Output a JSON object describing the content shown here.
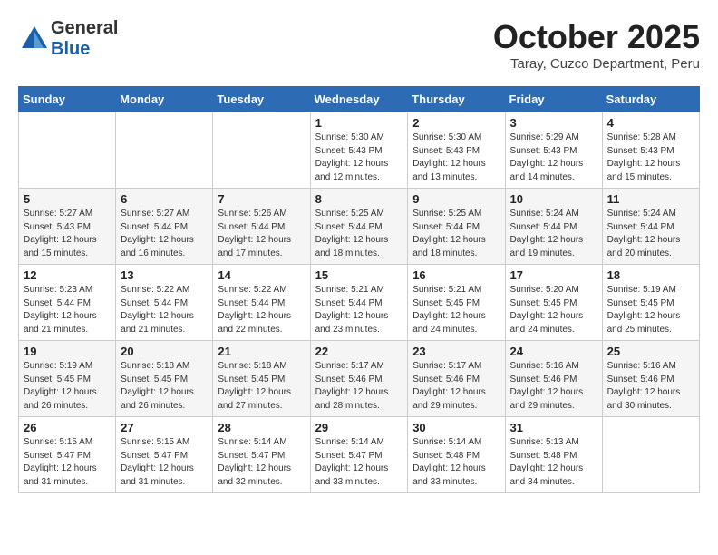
{
  "header": {
    "logo_general": "General",
    "logo_blue": "Blue",
    "month": "October 2025",
    "location": "Taray, Cuzco Department, Peru"
  },
  "weekdays": [
    "Sunday",
    "Monday",
    "Tuesday",
    "Wednesday",
    "Thursday",
    "Friday",
    "Saturday"
  ],
  "weeks": [
    [
      {
        "day": "",
        "info": ""
      },
      {
        "day": "",
        "info": ""
      },
      {
        "day": "",
        "info": ""
      },
      {
        "day": "1",
        "info": "Sunrise: 5:30 AM\nSunset: 5:43 PM\nDaylight: 12 hours\nand 12 minutes."
      },
      {
        "day": "2",
        "info": "Sunrise: 5:30 AM\nSunset: 5:43 PM\nDaylight: 12 hours\nand 13 minutes."
      },
      {
        "day": "3",
        "info": "Sunrise: 5:29 AM\nSunset: 5:43 PM\nDaylight: 12 hours\nand 14 minutes."
      },
      {
        "day": "4",
        "info": "Sunrise: 5:28 AM\nSunset: 5:43 PM\nDaylight: 12 hours\nand 15 minutes."
      }
    ],
    [
      {
        "day": "5",
        "info": "Sunrise: 5:27 AM\nSunset: 5:43 PM\nDaylight: 12 hours\nand 15 minutes."
      },
      {
        "day": "6",
        "info": "Sunrise: 5:27 AM\nSunset: 5:44 PM\nDaylight: 12 hours\nand 16 minutes."
      },
      {
        "day": "7",
        "info": "Sunrise: 5:26 AM\nSunset: 5:44 PM\nDaylight: 12 hours\nand 17 minutes."
      },
      {
        "day": "8",
        "info": "Sunrise: 5:25 AM\nSunset: 5:44 PM\nDaylight: 12 hours\nand 18 minutes."
      },
      {
        "day": "9",
        "info": "Sunrise: 5:25 AM\nSunset: 5:44 PM\nDaylight: 12 hours\nand 18 minutes."
      },
      {
        "day": "10",
        "info": "Sunrise: 5:24 AM\nSunset: 5:44 PM\nDaylight: 12 hours\nand 19 minutes."
      },
      {
        "day": "11",
        "info": "Sunrise: 5:24 AM\nSunset: 5:44 PM\nDaylight: 12 hours\nand 20 minutes."
      }
    ],
    [
      {
        "day": "12",
        "info": "Sunrise: 5:23 AM\nSunset: 5:44 PM\nDaylight: 12 hours\nand 21 minutes."
      },
      {
        "day": "13",
        "info": "Sunrise: 5:22 AM\nSunset: 5:44 PM\nDaylight: 12 hours\nand 21 minutes."
      },
      {
        "day": "14",
        "info": "Sunrise: 5:22 AM\nSunset: 5:44 PM\nDaylight: 12 hours\nand 22 minutes."
      },
      {
        "day": "15",
        "info": "Sunrise: 5:21 AM\nSunset: 5:44 PM\nDaylight: 12 hours\nand 23 minutes."
      },
      {
        "day": "16",
        "info": "Sunrise: 5:21 AM\nSunset: 5:45 PM\nDaylight: 12 hours\nand 24 minutes."
      },
      {
        "day": "17",
        "info": "Sunrise: 5:20 AM\nSunset: 5:45 PM\nDaylight: 12 hours\nand 24 minutes."
      },
      {
        "day": "18",
        "info": "Sunrise: 5:19 AM\nSunset: 5:45 PM\nDaylight: 12 hours\nand 25 minutes."
      }
    ],
    [
      {
        "day": "19",
        "info": "Sunrise: 5:19 AM\nSunset: 5:45 PM\nDaylight: 12 hours\nand 26 minutes."
      },
      {
        "day": "20",
        "info": "Sunrise: 5:18 AM\nSunset: 5:45 PM\nDaylight: 12 hours\nand 26 minutes."
      },
      {
        "day": "21",
        "info": "Sunrise: 5:18 AM\nSunset: 5:45 PM\nDaylight: 12 hours\nand 27 minutes."
      },
      {
        "day": "22",
        "info": "Sunrise: 5:17 AM\nSunset: 5:46 PM\nDaylight: 12 hours\nand 28 minutes."
      },
      {
        "day": "23",
        "info": "Sunrise: 5:17 AM\nSunset: 5:46 PM\nDaylight: 12 hours\nand 29 minutes."
      },
      {
        "day": "24",
        "info": "Sunrise: 5:16 AM\nSunset: 5:46 PM\nDaylight: 12 hours\nand 29 minutes."
      },
      {
        "day": "25",
        "info": "Sunrise: 5:16 AM\nSunset: 5:46 PM\nDaylight: 12 hours\nand 30 minutes."
      }
    ],
    [
      {
        "day": "26",
        "info": "Sunrise: 5:15 AM\nSunset: 5:47 PM\nDaylight: 12 hours\nand 31 minutes."
      },
      {
        "day": "27",
        "info": "Sunrise: 5:15 AM\nSunset: 5:47 PM\nDaylight: 12 hours\nand 31 minutes."
      },
      {
        "day": "28",
        "info": "Sunrise: 5:14 AM\nSunset: 5:47 PM\nDaylight: 12 hours\nand 32 minutes."
      },
      {
        "day": "29",
        "info": "Sunrise: 5:14 AM\nSunset: 5:47 PM\nDaylight: 12 hours\nand 33 minutes."
      },
      {
        "day": "30",
        "info": "Sunrise: 5:14 AM\nSunset: 5:48 PM\nDaylight: 12 hours\nand 33 minutes."
      },
      {
        "day": "31",
        "info": "Sunrise: 5:13 AM\nSunset: 5:48 PM\nDaylight: 12 hours\nand 34 minutes."
      },
      {
        "day": "",
        "info": ""
      }
    ]
  ]
}
